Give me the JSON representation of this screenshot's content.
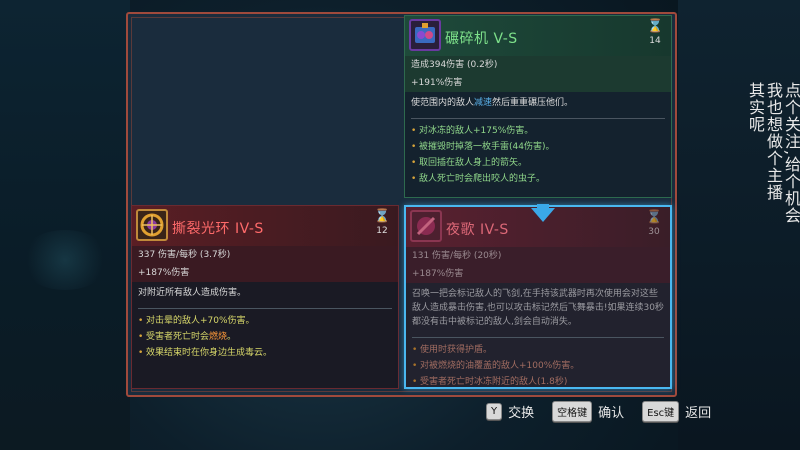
{
  "cards": {
    "grinder": {
      "title": "碾碎机  V-S",
      "timer_icon": "hourglass-icon",
      "timer": "14",
      "stat1": "造成394伤害 (0.2秒)",
      "stat2": "+191%伤害",
      "desc_pre": "使范围内的敌人",
      "desc_hl": "减速",
      "desc_post": "然后重重碾压他们。",
      "bullets": [
        "对冰冻的敌人+175%伤害。",
        "被摧毁时掉落一枚手雷(44伤害)。",
        "取回插在敌人身上的箭矢。",
        "敌人死亡时会爬出咬人的虫子。"
      ]
    },
    "ring": {
      "title": "撕裂光环  IV-S",
      "timer": "12",
      "stat1": "337 伤害/每秒 (3.7秒)",
      "stat2": "+187%伤害",
      "desc": "对附近所有敌人造成伤害。",
      "bullet1": "对击晕的敌人+70%伤害。",
      "bullet2_pre": "受害者死亡时会",
      "bullet2_hl": "燃烧",
      "bullet2_post": "。",
      "bullet3": "效果结束时在你身边生成毒云。"
    },
    "nightsong": {
      "title": "夜歌  IV-S",
      "timer": "30",
      "stat1": "131 伤害/每秒 (20秒)",
      "stat2": "+187%伤害",
      "desc": "召唤一把会标记敌人的飞剑,在手持该武器时再次使用会对这些敌人造成暴击伤害,也可以攻击标记然后飞舞暴击!如果连续30秒都没有击中被标记的敌人,剑会自动消失。",
      "bullets": [
        "使用时获得护盾。",
        "对被燃烧的油覆盖的敌人+100%伤害。",
        "受害者死亡时冰冻附近的敌人(1.8秒)"
      ]
    }
  },
  "controls": [
    {
      "key": "Y",
      "label": "交换"
    },
    {
      "key": "空格键",
      "label": "确认"
    },
    {
      "key": "Esc键",
      "label": "返回"
    }
  ],
  "side_text": {
    "col1": "点个关注,给个机会",
    "col2": "我也想做个主播",
    "col3": "其实呢"
  },
  "colors": {
    "frame": "#a04a3c",
    "grinder_accent": "#7de08a",
    "ring_accent": "#ff6a6a",
    "selection": "#4ab8f0",
    "timer": "#e6a63a"
  }
}
